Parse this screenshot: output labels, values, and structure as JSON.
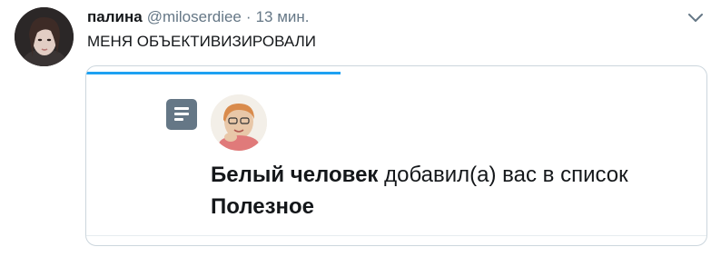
{
  "tweet": {
    "author_name": "палина",
    "author_handle": "@miloserdiee",
    "separator": "·",
    "timestamp": "13 мин.",
    "text": "МЕНЯ ОБЪЕКТИВИЗИРОВАЛИ",
    "caret_icon": "chevron-down-icon"
  },
  "card": {
    "icon": "list-icon",
    "progress_fraction": 0.41,
    "notification": {
      "actor_name": "Белый человек",
      "action_text": "добавил(а) вас в список",
      "list_name": "Полезное"
    }
  },
  "colors": {
    "accent": "#1da1f2",
    "secondary_text": "#657786",
    "border": "#ccd6dd"
  }
}
